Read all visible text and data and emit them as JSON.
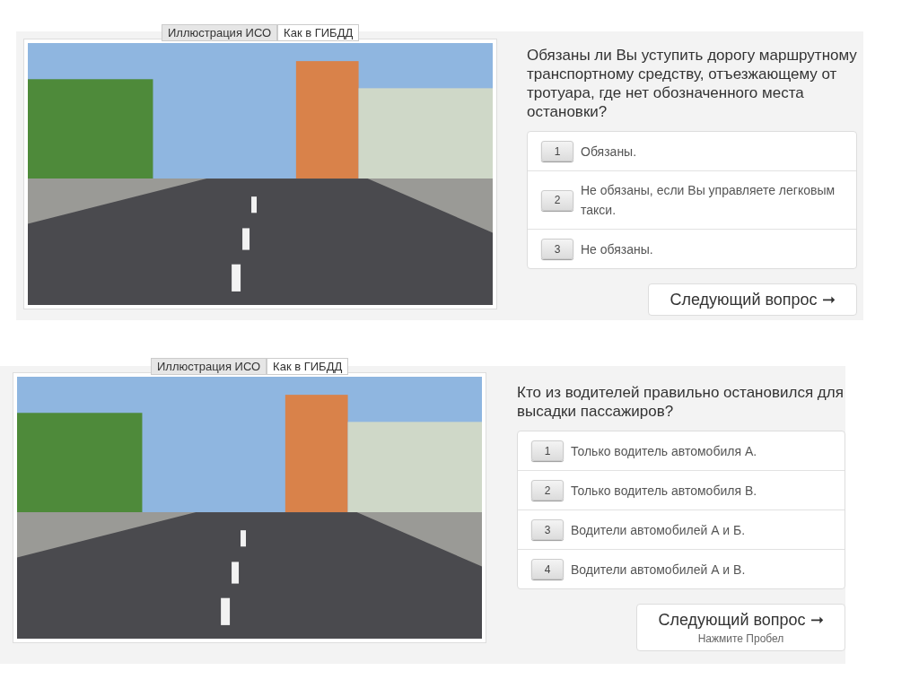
{
  "questions": [
    {
      "tabs": [
        {
          "label": "Иллюстрация ИСО",
          "selected": true
        },
        {
          "label": "Как в ГИБДД",
          "selected": false
        }
      ],
      "question": "Обязаны ли Вы уступить дорогу маршрутному транспортному средству, отъезжающему от тротуара, где нет обозначенного места остановки?",
      "answers": [
        {
          "key": "1",
          "text": "Обязаны."
        },
        {
          "key": "2",
          "text": "Не обязаны, если Вы управляете легковым такси."
        },
        {
          "key": "3",
          "text": "Не обязаны."
        }
      ],
      "next_button": {
        "label": "Следующий вопрос ➞"
      }
    },
    {
      "tabs": [
        {
          "label": "Иллюстрация ИСО",
          "selected": true
        },
        {
          "label": "Как в ГИБДД",
          "selected": false
        }
      ],
      "question": "Кто из водителей правильно остановился для высадки пассажиров?",
      "answers": [
        {
          "key": "1",
          "text": "Только водитель автомобиля А."
        },
        {
          "key": "2",
          "text": "Только водитель автомобиля В."
        },
        {
          "key": "3",
          "text": "Водители автомобилей А и Б."
        },
        {
          "key": "4",
          "text": "Водители автомобилей А и В."
        }
      ],
      "next_button": {
        "label": "Следующий вопрос ➞",
        "hint": "Нажмите Пробел"
      }
    }
  ]
}
